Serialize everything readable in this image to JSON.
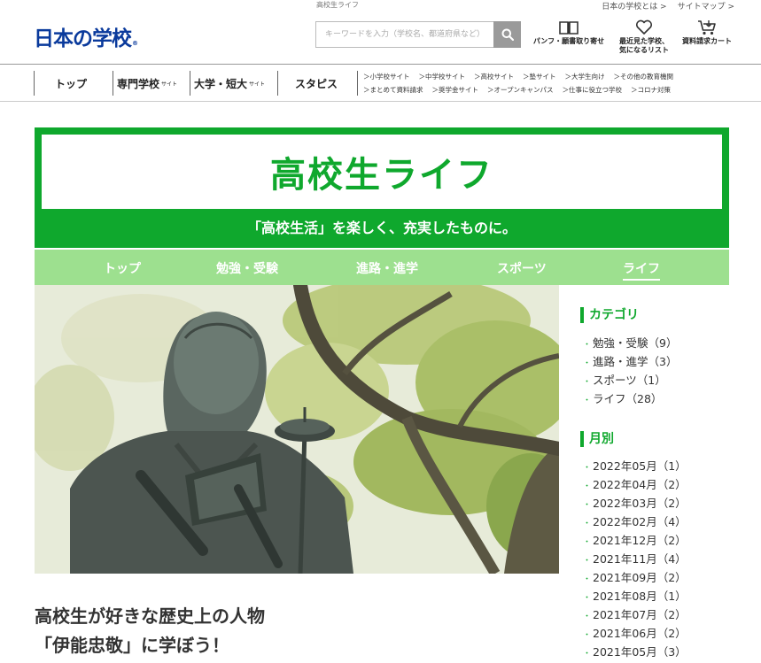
{
  "header": {
    "tagline": "高校生ライフ",
    "top_links": [
      "日本の学校とは >",
      "サイトマップ >"
    ],
    "logo_text": "日本の学校",
    "logo_mark": "®",
    "search_placeholder": "キーワードを入力（学校名、都道府県など）",
    "icons": [
      {
        "name": "pamphlet",
        "line1": "パンフ・願書取り寄せ",
        "line2": ""
      },
      {
        "name": "recent",
        "line1": "最近見た学校、",
        "line2": "気になるリスト"
      },
      {
        "name": "cart",
        "line1": "資料請求カート",
        "line2": ""
      }
    ]
  },
  "gnav": {
    "main": [
      {
        "label": "トップ",
        "suffix": ""
      },
      {
        "label": "専門学校",
        "suffix": "サイト"
      },
      {
        "label": "大学・短大",
        "suffix": "サイト"
      },
      {
        "label": "スタピス",
        "suffix": ""
      }
    ],
    "sub_row1": [
      "＞小学校サイト",
      "＞中学校サイト",
      "＞高校サイト",
      "＞塾サイト",
      "＞大学生向け",
      "＞その他の教育機関"
    ],
    "sub_row2": [
      "＞まとめて資料請求",
      "＞奨学金サイト",
      "＞オープンキャンパス",
      "＞仕事に役立つ学校",
      "＞コロナ対策"
    ]
  },
  "banner": {
    "title": "高校生ライフ",
    "subtitle": "「高校生活」を楽しく、充実したものに。"
  },
  "category_nav": [
    {
      "label": "トップ",
      "active": false
    },
    {
      "label": "勉強・受験",
      "active": false
    },
    {
      "label": "進路・進学",
      "active": false
    },
    {
      "label": "スポーツ",
      "active": false
    },
    {
      "label": "ライフ",
      "active": true
    }
  ],
  "article": {
    "title_line1": "高校生が好きな歴史上の人物",
    "title_line2": "「伊能忠敬」に学ぼう！"
  },
  "sidebar": {
    "category_heading": "カテゴリ",
    "categories": [
      "勉強・受験（9）",
      "進路・進学（3）",
      "スポーツ（1）",
      "ライフ（28）"
    ],
    "month_heading": "月別",
    "months": [
      "2022年05月（1）",
      "2022年04月（2）",
      "2022年03月（2）",
      "2022年02月（4）",
      "2021年12月（2）",
      "2021年11月（4）",
      "2021年09月（2）",
      "2021年08月（1）",
      "2021年07月（2）",
      "2021年06月（2）",
      "2021年05月（3）"
    ]
  },
  "colors": {
    "brand_green": "#0fa82d",
    "nav_green": "#9de08f",
    "logo_blue": "#0a3a9c",
    "logo_accent": "#1a8fe0"
  }
}
